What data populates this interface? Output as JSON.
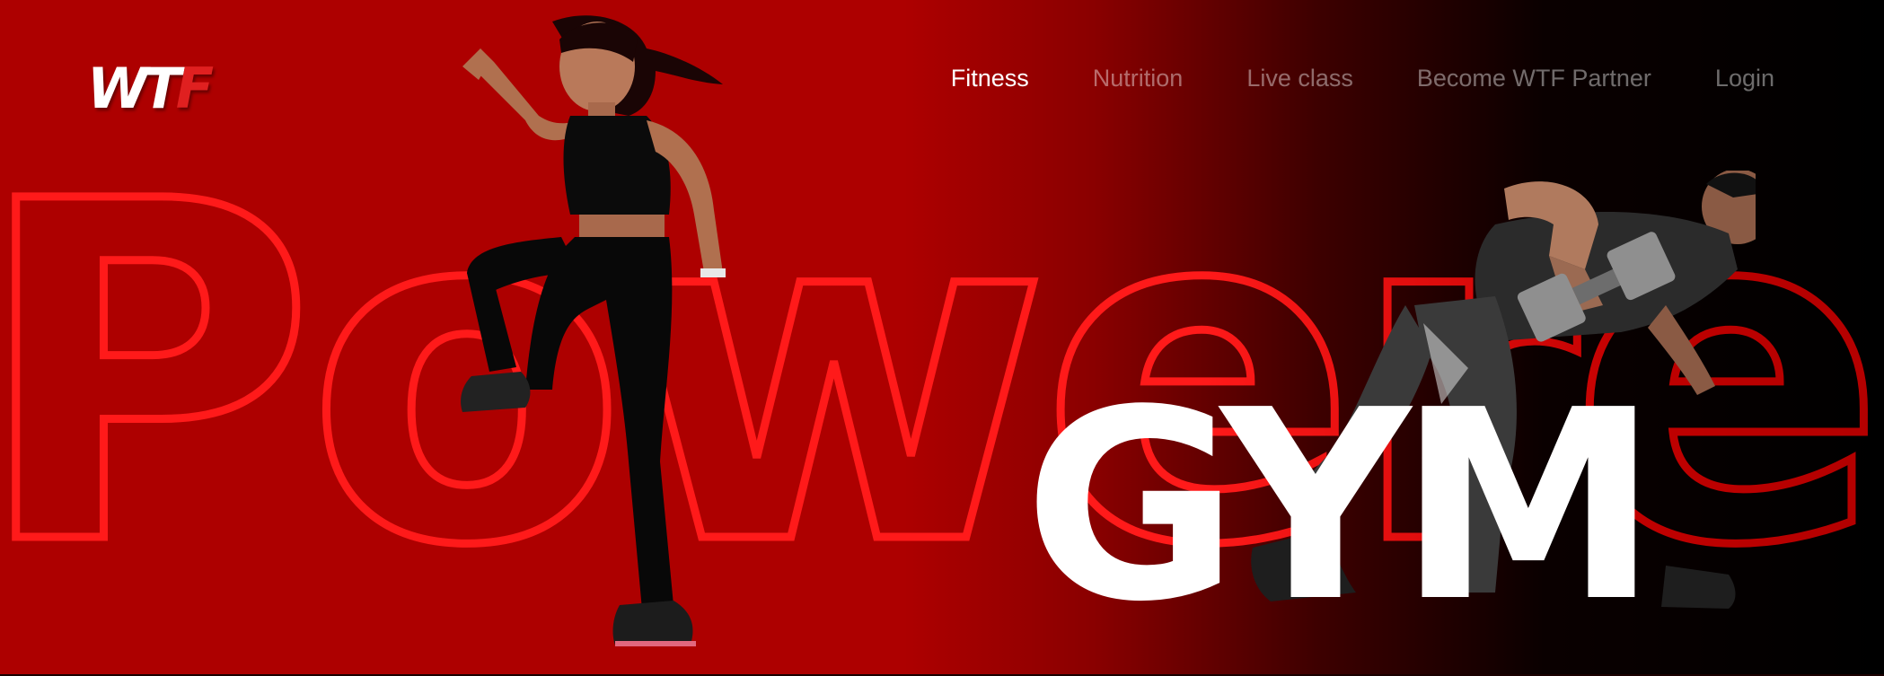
{
  "brand": {
    "logo_main": "WT",
    "logo_accent": "F",
    "accent_color": "#e02020",
    "primary_red": "#ad0000"
  },
  "nav": {
    "items": [
      {
        "label": "Fitness",
        "active": true
      },
      {
        "label": "Nutrition",
        "active": false
      },
      {
        "label": "Live class",
        "active": false
      },
      {
        "label": "Become WTF Partner",
        "active": false
      },
      {
        "label": "Login",
        "active": false
      }
    ]
  },
  "hero": {
    "outline_word": "Powered",
    "headline": "GYM"
  },
  "images": {
    "woman": "woman-runner-image",
    "man": "man-dumbbell-image"
  }
}
